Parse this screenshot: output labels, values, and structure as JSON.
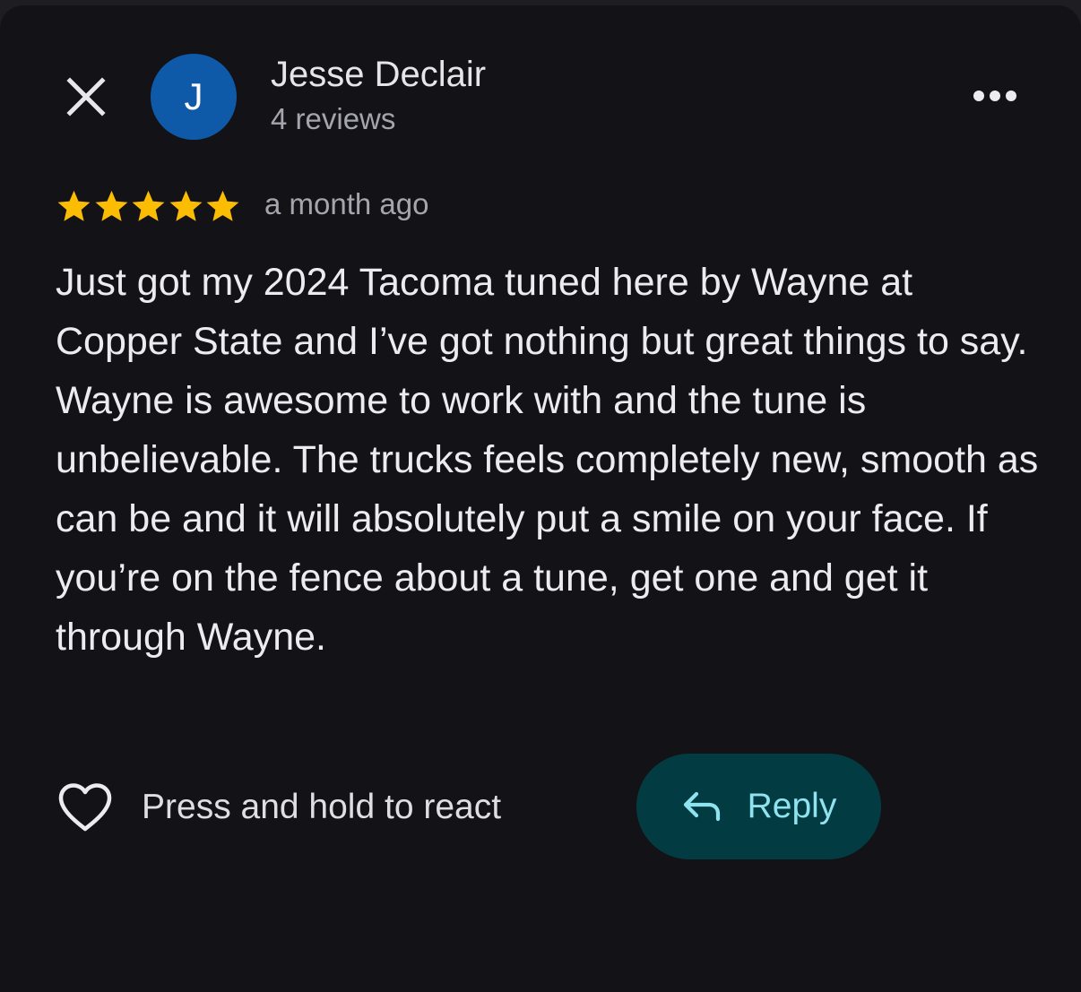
{
  "header": {
    "close_icon": "close-icon",
    "more_icon": "more-horizontal-icon"
  },
  "reviewer": {
    "initial": "J",
    "name": "Jesse Declair",
    "meta": "4 reviews",
    "avatar_color": "#0f5aa8"
  },
  "review": {
    "rating": 5,
    "rating_max": 5,
    "star_icon": "star-icon",
    "star_color": "#fbbc04",
    "time": "a month ago",
    "text": "Just got my 2024 Tacoma tuned here by Wayne at Copper State and I’ve got nothing but great things to say. Wayne is awesome to work with and the tune is unbelievable. The trucks feels completely new, smooth as can be and it will absolutely put a smile on your face. If you’re on the fence about a tune, get one and get it through Wayne."
  },
  "actions": {
    "react_icon": "heart-outline-icon",
    "react_label": "Press and hold to react",
    "reply_icon": "reply-arrow-icon",
    "reply_label": "Reply",
    "reply_bg": "#033b42",
    "reply_text_color": "#8fe3ef"
  }
}
